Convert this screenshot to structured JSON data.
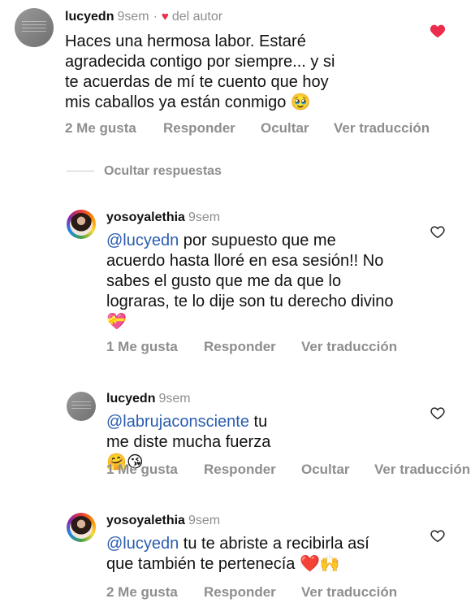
{
  "comments": [
    {
      "username": "lucyedn",
      "time": "9sem",
      "author_label": "del autor",
      "text": "Haces una hermosa labor.  Estaré agradecida contigo por siempre... y si te acuerdas de mí te cuento que hoy mis caballos ya están conmigo 🥹",
      "likes": "2 Me gusta",
      "reply": "Responder",
      "hide": "Ocultar",
      "translate": "Ver traducción",
      "liked": true
    },
    {
      "username": "yosoyalethia",
      "time": "9sem",
      "mention": "@lucyedn",
      "text": " por supuesto que me acuerdo hasta lloré en esa sesión!! No sabes el gusto que me da que lo lograras, te lo dije son tu derecho divino 💝",
      "likes": "1 Me gusta",
      "reply": "Responder",
      "translate": "Ver traducción",
      "liked": false
    },
    {
      "username": "lucyedn",
      "time": "9sem",
      "mention": "@labrujaconsciente",
      "text": " tu me diste mucha fuerza 🤗😘",
      "likes": "1 Me gusta",
      "reply": "Responder",
      "hide": "Ocultar",
      "translate": "Ver traducción",
      "liked": false
    },
    {
      "username": "yosoyalethia",
      "time": "9sem",
      "mention": "@lucyedn",
      "text": " tu te abriste a recibirla así que también te pertenecía ❤️🙌",
      "likes": "2 Me gusta",
      "reply": "Responder",
      "translate": "Ver traducción",
      "liked": false
    }
  ],
  "hide_replies_label": "Ocultar respuestas",
  "icons": {
    "liked_heart": "heart-filled-icon",
    "like": "heart-outline-icon",
    "author_heart": "heart-filled-icon"
  },
  "colors": {
    "heart_red": "#ed2b4a",
    "mention_blue": "#2a5db0",
    "muted_gray": "#8e8e8e"
  }
}
